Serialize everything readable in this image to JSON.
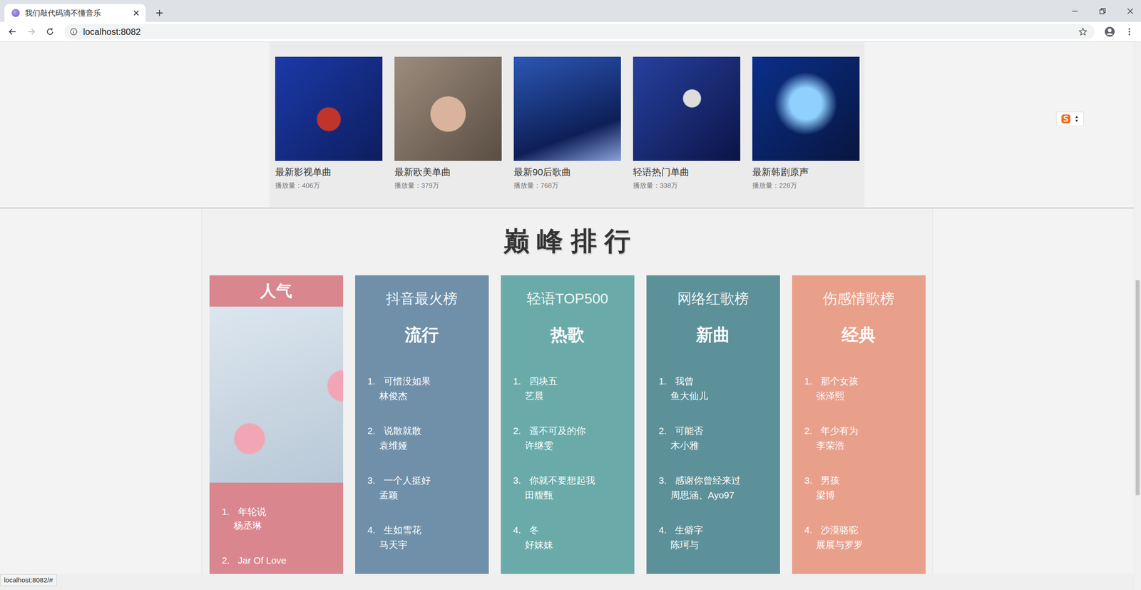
{
  "window": {
    "title": "我们敲代码滴不懂音乐"
  },
  "browser": {
    "url": "localhost:8082",
    "status": "localhost:8082/#",
    "bookmarked": false
  },
  "playlists": [
    {
      "title": "最新影视单曲",
      "plays": "播放量：406万"
    },
    {
      "title": "最新欧美单曲",
      "plays": "播放量：379万"
    },
    {
      "title": "最新90后歌曲",
      "plays": "播放量：768万"
    },
    {
      "title": "轻语热门单曲",
      "plays": "播放量：338万"
    },
    {
      "title": "最新韩剧原声",
      "plays": "播放量：228万"
    }
  ],
  "ranking": {
    "title": "巅峰排行",
    "featured": {
      "label": "人气",
      "color": "#d9868f",
      "songs": [
        {
          "rank": "1.",
          "title": "年轮说",
          "artist": "杨丞琳"
        },
        {
          "rank": "2.",
          "title": "Jar Of Love",
          "artist": ""
        }
      ]
    },
    "charts": [
      {
        "name": "抖音最火榜",
        "category": "流行",
        "color": "#7090a9",
        "songs": [
          {
            "rank": "1.",
            "title": "可惜没如果",
            "artist": "林俊杰"
          },
          {
            "rank": "2.",
            "title": "说散就散",
            "artist": "袁维娅"
          },
          {
            "rank": "3.",
            "title": "一个人挺好",
            "artist": "孟颖"
          },
          {
            "rank": "4.",
            "title": "生如雪花",
            "artist": "马天宇"
          }
        ]
      },
      {
        "name": "轻语TOP500",
        "category": "热歌",
        "color": "#6aaba9",
        "songs": [
          {
            "rank": "1.",
            "title": "四块五",
            "artist": "艺晨"
          },
          {
            "rank": "2.",
            "title": "遥不可及的你",
            "artist": "许继雯"
          },
          {
            "rank": "3.",
            "title": "你就不要想起我",
            "artist": "田馥甄"
          },
          {
            "rank": "4.",
            "title": "冬",
            "artist": "好妹妹"
          }
        ]
      },
      {
        "name": "网络红歌榜",
        "category": "新曲",
        "color": "#5d9199",
        "songs": [
          {
            "rank": "1.",
            "title": "我曾",
            "artist": "鱼大仙儿"
          },
          {
            "rank": "2.",
            "title": "可能否",
            "artist": "木小雅"
          },
          {
            "rank": "3.",
            "title": "感谢你曾经来过",
            "artist": "周思涵、Ayo97"
          },
          {
            "rank": "4.",
            "title": "生僻字",
            "artist": "陈珂与"
          }
        ]
      },
      {
        "name": "伤感情歌榜",
        "category": "经典",
        "color": "#e9a08b",
        "songs": [
          {
            "rank": "1.",
            "title": "那个女孩",
            "artist": "张泽熙"
          },
          {
            "rank": "2.",
            "title": "年少有为",
            "artist": "李荣浩"
          },
          {
            "rank": "3.",
            "title": "男孩",
            "artist": "梁博"
          },
          {
            "rank": "4.",
            "title": "沙漠骆驼",
            "artist": "展展与罗罗"
          }
        ]
      }
    ]
  },
  "scrollbar": {
    "level": 0.435
  }
}
